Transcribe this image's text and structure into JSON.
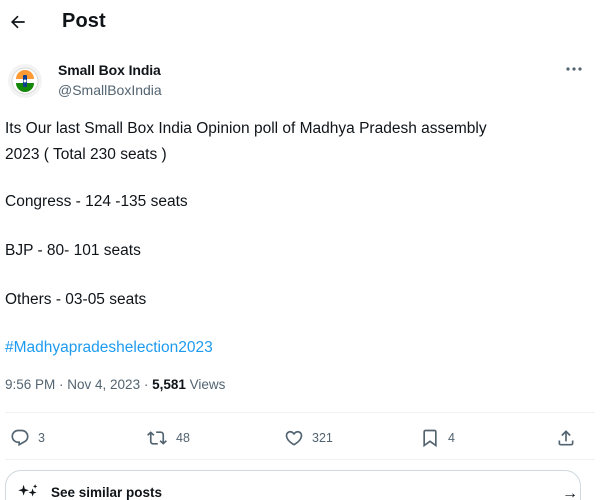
{
  "header": {
    "title": "Post"
  },
  "tweet": {
    "author_name": "Small Box India",
    "author_handle": "@SmallBoxIndia",
    "lines": [
      "Its Our last Small Box India Opinion poll of Madhya Pradesh assembly",
      "2023 ( Total 230 seats )",
      "Congress - 124 -135 seats",
      "BJP - 80- 101 seats",
      "Others - 03-05 seats"
    ],
    "hashtag": "#Madhyapradeshelection2023",
    "timestamp": "9:56 PM · Nov 4, 2023 · ",
    "views_count": "5,581",
    "views_label": " Views"
  },
  "actions": {
    "replies": "3",
    "reposts": "48",
    "likes": "321",
    "bookmarks": "4"
  },
  "similar": {
    "label": "See similar posts"
  },
  "icons": {
    "back": "arrow-left-icon",
    "more": "more-horizontal-icon",
    "reply": "reply-icon",
    "repost": "repost-icon",
    "like": "heart-icon",
    "bookmark": "bookmark-icon",
    "share": "share-icon",
    "similar": "sparkle-icon",
    "arrow": "arrow-right-icon"
  },
  "colors": {
    "text": "#0f1419",
    "muted": "#536471",
    "link": "#1d9bf0",
    "divider": "#eff3f4"
  }
}
